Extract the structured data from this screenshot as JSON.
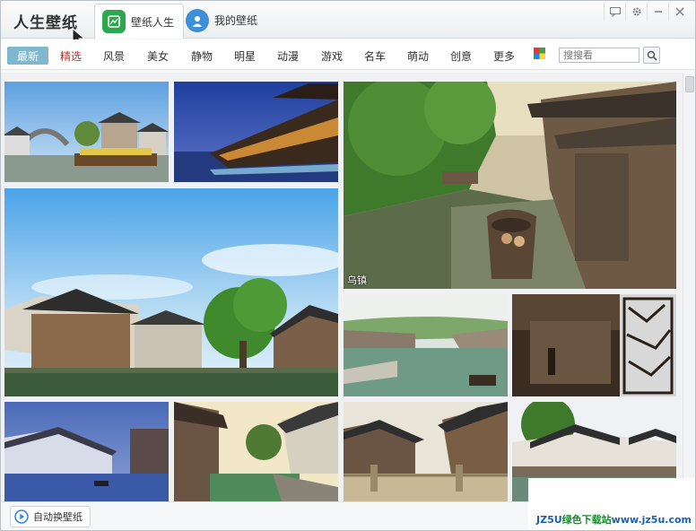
{
  "app": {
    "title": "人生壁纸"
  },
  "tabs": [
    {
      "label": "壁纸人生",
      "active": true,
      "icon": "wallpaper-app-icon"
    },
    {
      "label": "我的壁纸",
      "active": false,
      "icon": "user-avatar-icon"
    }
  ],
  "window_controls": [
    "feedback-icon",
    "settings-icon",
    "minimize-icon",
    "close-icon"
  ],
  "categories": [
    "最新",
    "精选",
    "风景",
    "美女",
    "静物",
    "明星",
    "动漫",
    "游戏",
    "名车",
    "萌动",
    "创意",
    "更多"
  ],
  "selected_category": "最新",
  "search": {
    "placeholder": "搜搜看",
    "value": ""
  },
  "thumbnails": [
    {
      "caption": ""
    },
    {
      "caption": ""
    },
    {
      "caption": "乌镇"
    },
    {
      "caption": ""
    },
    {
      "caption": ""
    },
    {
      "caption": ""
    },
    {
      "caption": ""
    },
    {
      "caption": ""
    },
    {
      "caption": ""
    },
    {
      "caption": ""
    }
  ],
  "bottom": {
    "auto_switch_label": "自动换壁纸"
  },
  "watermark": {
    "prefix": "JZ5U",
    "middle": "绿色下载站",
    "suffix": "www.jz5u.com"
  },
  "colors": {
    "accent": "#7fb7cc",
    "featured": "#d52b1e",
    "tab_green": "#2ea84f",
    "tab_blue": "#3d8fd8"
  }
}
